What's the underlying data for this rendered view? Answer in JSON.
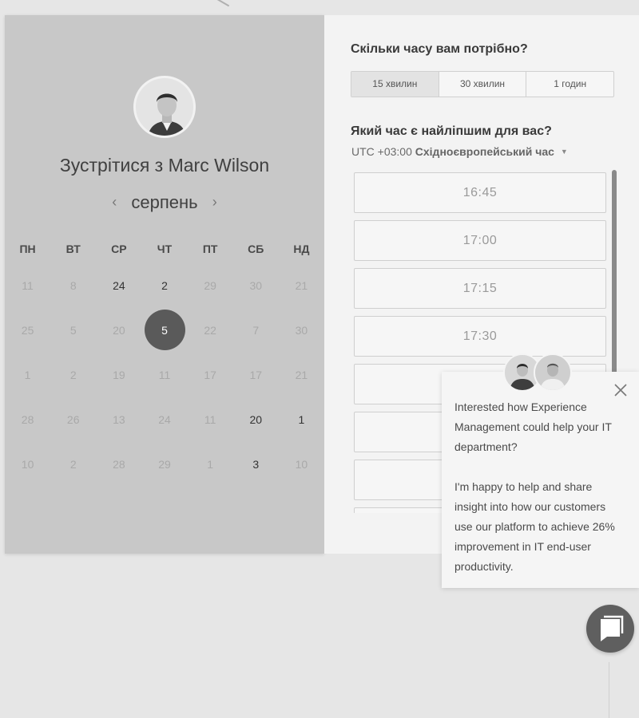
{
  "calendar": {
    "title": "Зустрітися з Marc Wilson",
    "month": "серпень",
    "prev_icon": "chevron-left-icon",
    "next_icon": "chevron-right-icon",
    "weekdays": [
      "ПН",
      "ВТ",
      "СР",
      "ЧТ",
      "ПТ",
      "СБ",
      "НД"
    ],
    "weeks": [
      [
        {
          "d": "11",
          "state": "unavailable"
        },
        {
          "d": "8",
          "state": "unavailable"
        },
        {
          "d": "24",
          "state": "available"
        },
        {
          "d": "2",
          "state": "available"
        },
        {
          "d": "29",
          "state": "unavailable"
        },
        {
          "d": "30",
          "state": "unavailable"
        },
        {
          "d": "21",
          "state": "unavailable"
        }
      ],
      [
        {
          "d": "25",
          "state": "unavailable"
        },
        {
          "d": "5",
          "state": "unavailable"
        },
        {
          "d": "20",
          "state": "unavailable"
        },
        {
          "d": "5",
          "state": "selected"
        },
        {
          "d": "22",
          "state": "unavailable"
        },
        {
          "d": "7",
          "state": "unavailable"
        },
        {
          "d": "30",
          "state": "unavailable"
        }
      ],
      [
        {
          "d": "1",
          "state": "unavailable"
        },
        {
          "d": "2",
          "state": "unavailable"
        },
        {
          "d": "19",
          "state": "unavailable"
        },
        {
          "d": "11",
          "state": "unavailable"
        },
        {
          "d": "17",
          "state": "unavailable"
        },
        {
          "d": "17",
          "state": "unavailable"
        },
        {
          "d": "21",
          "state": "unavailable"
        }
      ],
      [
        {
          "d": "28",
          "state": "unavailable"
        },
        {
          "d": "26",
          "state": "unavailable"
        },
        {
          "d": "13",
          "state": "unavailable"
        },
        {
          "d": "24",
          "state": "unavailable"
        },
        {
          "d": "11",
          "state": "unavailable"
        },
        {
          "d": "20",
          "state": "available"
        },
        {
          "d": "1",
          "state": "available"
        }
      ],
      [
        {
          "d": "10",
          "state": "unavailable"
        },
        {
          "d": "2",
          "state": "unavailable"
        },
        {
          "d": "28",
          "state": "unavailable"
        },
        {
          "d": "29",
          "state": "unavailable"
        },
        {
          "d": "1",
          "state": "unavailable"
        },
        {
          "d": "3",
          "state": "available"
        },
        {
          "d": "10",
          "state": "unavailable"
        }
      ]
    ]
  },
  "scheduler": {
    "duration_question": "Скільки часу вам потрібно?",
    "durations": [
      {
        "label": "15 хвилин",
        "active": true
      },
      {
        "label": "30 хвилин",
        "active": false
      },
      {
        "label": "1 годин",
        "active": false
      }
    ],
    "time_question": "Який час є найліпшим для вас?",
    "timezone_offset": "UTC +03:00",
    "timezone_name": "Східноєвропейський час",
    "timezone_icon": "caret-down-icon",
    "slots": [
      "16:45",
      "17:00",
      "17:15",
      "17:30",
      "",
      "",
      "",
      ""
    ]
  },
  "chat": {
    "message_1": "Interested how Experience Management could help your IT department?",
    "message_2": "I'm happy to help and share insight into how our customers use our platform to achieve 26% improvement in IT end-user productivity.",
    "close_icon": "close-icon",
    "launcher_icon": "chat-bubble-icon"
  },
  "colors": {
    "selected_day": "#5a5a5a",
    "left_panel_bg": "#c8c8c8",
    "right_panel_bg": "#f3f3f3",
    "chat_launcher": "#5f5f5f"
  }
}
